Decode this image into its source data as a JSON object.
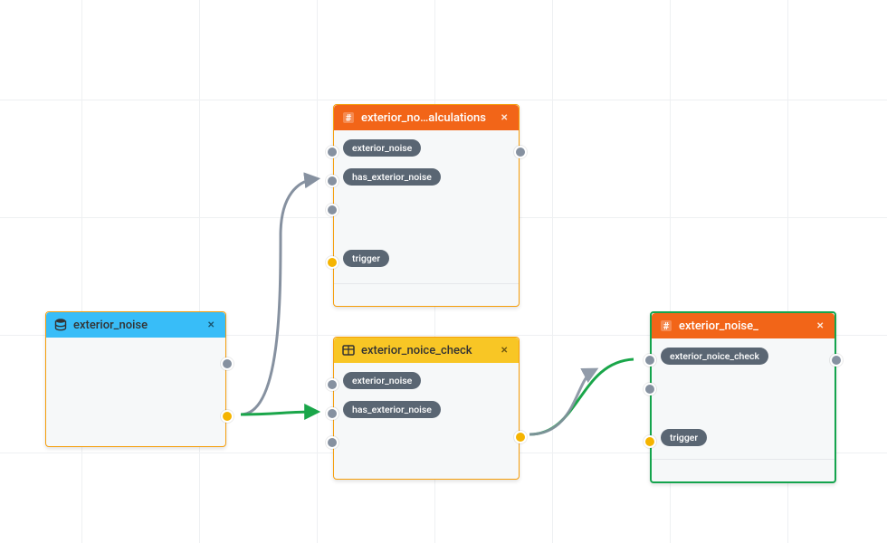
{
  "nodes": {
    "exterior_noise": {
      "title": "exterior_noise",
      "icon": "database-icon"
    },
    "calc": {
      "title": "exterior_no…alculations",
      "icon": "hash-icon",
      "ports": {
        "p1": "exterior_noise",
        "p2": "has_exterior_noise",
        "trigger": "trigger"
      }
    },
    "check": {
      "title": "exterior_noice_check",
      "icon": "table-icon",
      "ports": {
        "p1": "exterior_noise",
        "p2": "has_exterior_noise"
      }
    },
    "final": {
      "title": "exterior_noise_",
      "icon": "hash-icon",
      "ports": {
        "p1": "exterior_noice_check",
        "trigger": "trigger"
      }
    }
  },
  "close_glyph": "×"
}
